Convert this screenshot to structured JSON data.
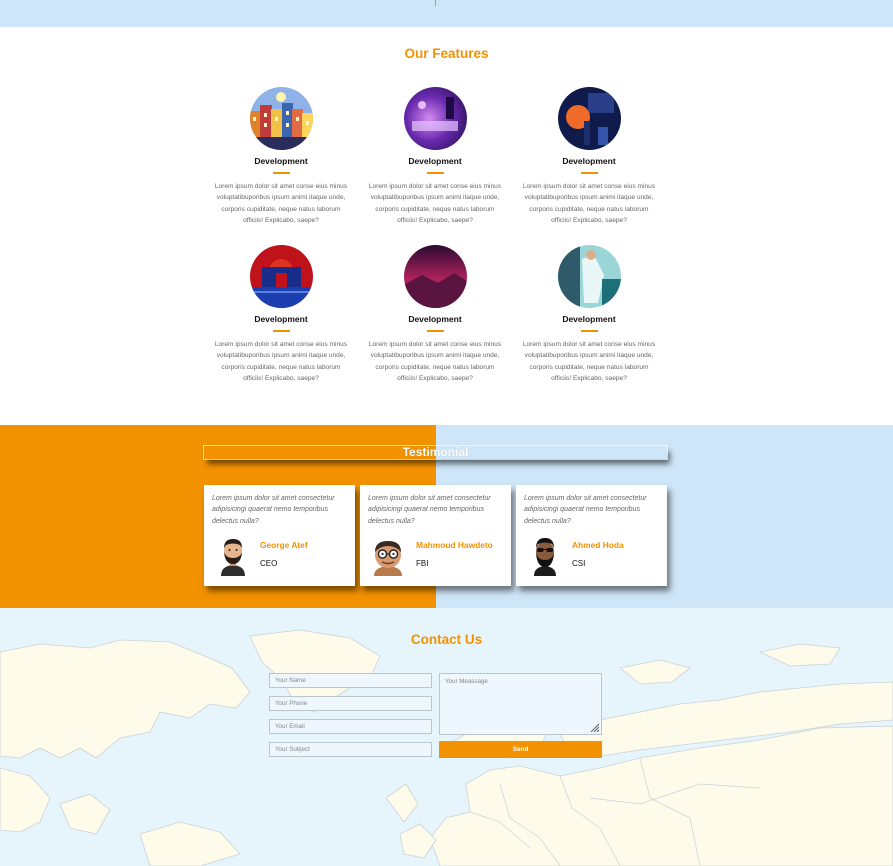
{
  "colors": {
    "accent": "#f39200",
    "light_blue": "#cfe6f8",
    "map_water": "#e6f4fc",
    "map_land": "#fffbea"
  },
  "features": {
    "title": "Our Features",
    "items": [
      {
        "title": "Development",
        "text": "Lorem ipsum dolor sit amet conse eius minus voluptatibuporibus ipsum animi itaque unde, corporis cupiditate, neque natus laborum officiis! Explicabo, saepe?",
        "image": "city-illustration"
      },
      {
        "title": "Development",
        "text": "Lorem ipsum dolor sit amet conse eius minus voluptatibuporibus ipsum animi itaque unde, corporis cupiditate, neque natus laborum officiis! Explicabo, saepe?",
        "image": "purple-room-illustration"
      },
      {
        "title": "Development",
        "text": "Lorem ipsum dolor sit amet conse eius minus voluptatibuporibus ipsum animi itaque unde, corporis cupiditate, neque natus laborum officiis! Explicabo, saepe?",
        "image": "night-figure-illustration"
      },
      {
        "title": "Development",
        "text": "Lorem ipsum dolor sit amet conse eius minus voluptatibuporibus ipsum animi itaque unde, corporis cupiditate, neque natus laborum officiis! Explicabo, saepe?",
        "image": "red-gateway-illustration"
      },
      {
        "title": "Development",
        "text": "Lorem ipsum dolor sit amet conse eius minus voluptatibuporibus ipsum animi itaque unde, corporis cupiditate, neque natus laborum officiis! Explicabo, saepe?",
        "image": "pink-landscape-illustration"
      },
      {
        "title": "Development",
        "text": "Lorem ipsum dolor sit amet conse eius minus voluptatibuporibus ipsum animi itaque unde, corporis cupiditate, neque natus laborum officiis! Explicabo, saepe?",
        "image": "teal-figure-illustration"
      }
    ]
  },
  "testimonial": {
    "title": "Testimonial",
    "cards": [
      {
        "quote": "Lorem ipsum dolor sit amet consectetur adipisicingi quaerat nemo temporibus delectus nulla?",
        "name": "George Atef",
        "role": "CEO",
        "avatar": "bearded-man-avatar"
      },
      {
        "quote": "Lorem ipsum dolor sit amet consectetur adipisicingi quaerat nemo temporibus delectus nulla?",
        "name": "Mahmoud Hawdeto",
        "role": "FBI",
        "avatar": "glasses-man-avatar"
      },
      {
        "quote": "Lorem ipsum dolor sit amet consectetur adipisicingi quaerat nemo temporibus delectus nulla?",
        "name": "Ahmed Hoda",
        "role": "CSI",
        "avatar": "sunglasses-man-avatar"
      }
    ]
  },
  "contact": {
    "title": "Contact Us",
    "name_placeholder": "Your Name",
    "phone_placeholder": "Your Phone",
    "email_placeholder": "Your Email",
    "subject_placeholder": "Your Subject",
    "message_placeholder": "Your Meassage",
    "send_label": "Send",
    "background": "world-map"
  }
}
